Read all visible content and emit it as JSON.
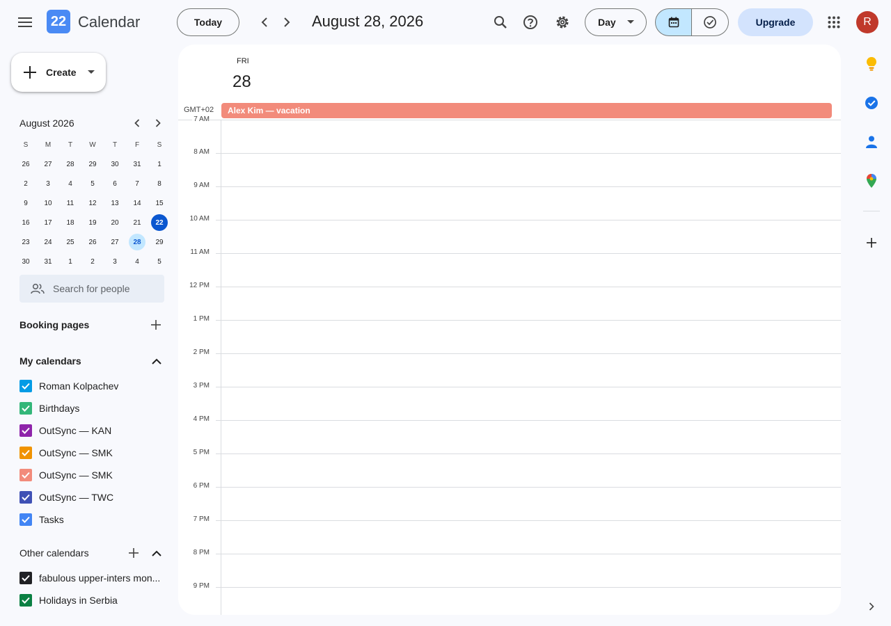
{
  "header": {
    "app_title": "Calendar",
    "logo_day": "22",
    "today_label": "Today",
    "date_title": "August 28, 2026",
    "view_label": "Day",
    "upgrade_label": "Upgrade",
    "avatar_initial": "R"
  },
  "sidebar": {
    "create_label": "Create",
    "mini_calendar": {
      "month_title": "August 2026",
      "weekday_headers": [
        "S",
        "M",
        "T",
        "W",
        "T",
        "F",
        "S"
      ],
      "days": [
        "26",
        "27",
        "28",
        "29",
        "30",
        "31",
        "1",
        "2",
        "3",
        "4",
        "5",
        "6",
        "7",
        "8",
        "9",
        "10",
        "11",
        "12",
        "13",
        "14",
        "15",
        "16",
        "17",
        "18",
        "19",
        "20",
        "21",
        "22",
        "23",
        "24",
        "25",
        "26",
        "27",
        "28",
        "29",
        "30",
        "31",
        "1",
        "2",
        "3",
        "4",
        "5"
      ],
      "today": "22",
      "selected": "28"
    },
    "search_people_placeholder": "Search for people",
    "booking_pages_label": "Booking pages",
    "my_calendars_label": "My calendars",
    "my_calendars": [
      {
        "label": "Roman Kolpachev",
        "color": "#039be5"
      },
      {
        "label": "Birthdays",
        "color": "#33b679"
      },
      {
        "label": "OutSync — KAN",
        "color": "#8e24aa"
      },
      {
        "label": "OutSync — SMK",
        "color": "#f09300"
      },
      {
        "label": "OutSync — SMK",
        "color": "#f28b7b"
      },
      {
        "label": "OutSync — TWC",
        "color": "#3f51b5"
      },
      {
        "label": "Tasks",
        "color": "#4285f4"
      }
    ],
    "other_calendars_label": "Other calendars",
    "other_calendars": [
      {
        "label": "fabulous upper-inters mon...",
        "color": "#202124"
      },
      {
        "label": "Holidays in Serbia",
        "color": "#0b8043"
      }
    ]
  },
  "main": {
    "day_name": "FRI",
    "day_number": "28",
    "timezone": "GMT+02",
    "allday_event": {
      "title": "Alex Kim — vacation",
      "color": "#f28b7b"
    },
    "hours": [
      "7 AM",
      "8 AM",
      "9 AM",
      "10 AM",
      "11 AM",
      "12 PM",
      "1 PM",
      "2 PM",
      "3 PM",
      "4 PM",
      "5 PM",
      "6 PM",
      "7 PM",
      "8 PM",
      "9 PM"
    ]
  }
}
